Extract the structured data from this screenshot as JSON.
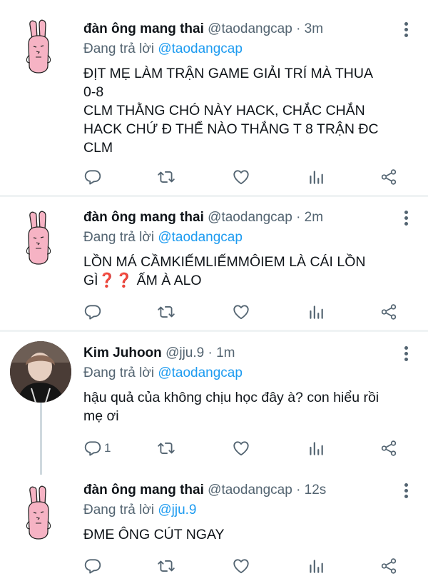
{
  "colors": {
    "accent": "#1d9bf0",
    "text": "#0f1419",
    "muted": "#536471",
    "divider": "#eff3f4",
    "avatar_pink": "#f6b3c4"
  },
  "icons": [
    "more-icon",
    "reply-icon",
    "retweet-icon",
    "like-icon",
    "analytics-icon",
    "share-icon",
    "rabbit-avatar-icon"
  ],
  "tweets": [
    {
      "name": "đàn ông mang thai",
      "handle": "@taodangcap",
      "dot": "·",
      "time": "3m",
      "reply_prefix": "Đang trả lời",
      "reply_to": "@taodangcap",
      "lines": [
        "ĐỊT MẸ LÀM TRẬN GAME GIẢI TRÍ MÀ THUA",
        "0-8",
        "CLM THẰNG CHÓ NÀY HACK, CHẮC CHẮN",
        "HACK CHỨ Đ THỂ NÀO THẮNG T 8 TRẬN ĐC",
        "CLM"
      ],
      "reply_count": ""
    },
    {
      "name": "đàn ông mang thai",
      "handle": "@taodangcap",
      "dot": "·",
      "time": "2m",
      "reply_prefix": "Đang trả lời",
      "reply_to": "@taodangcap",
      "lines": [
        "LỒN MÁ CẦMKIẾMLIẾMMÔIEM LÀ CÁI LỒN",
        "GÌ❓❓ ẤM À ALO"
      ],
      "reply_count": ""
    },
    {
      "name": "Kim Juhoon",
      "handle": "@jju.9",
      "dot": "·",
      "time": "1m",
      "reply_prefix": "Đang trả lời",
      "reply_to": "@taodangcap",
      "lines": [
        "hậu quả của không chịu học đây à? con hiểu rồi",
        "mẹ ơi"
      ],
      "reply_count": "1"
    },
    {
      "name": "đàn ông mang thai",
      "handle": "@taodangcap",
      "dot": "·",
      "time": "12s",
      "reply_prefix": "Đang trả lời",
      "reply_to": "@jju.9",
      "lines": [
        "ĐME ÔNG CÚT NGAY"
      ],
      "reply_count": ""
    }
  ]
}
